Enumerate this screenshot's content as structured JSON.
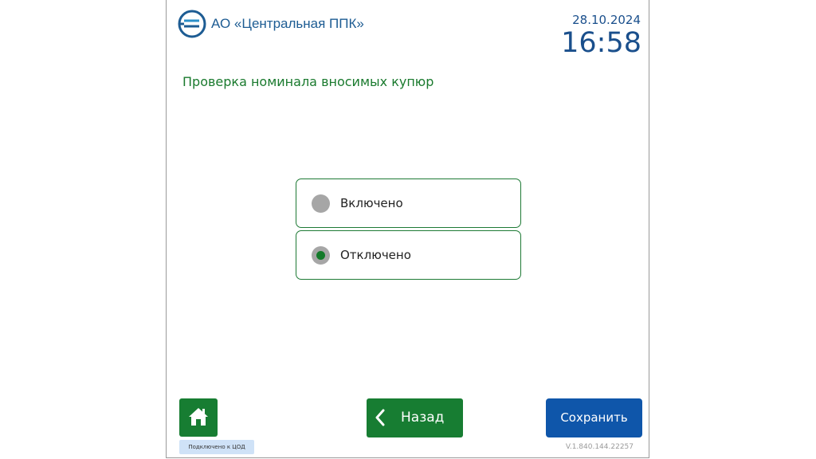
{
  "header": {
    "company": "АО «Центральная ППК»",
    "logo_icon": "company-logo-icon",
    "date": "28.10.2024",
    "time": "16:58"
  },
  "page": {
    "title": "Проверка номинала вносимых купюр"
  },
  "options": [
    {
      "label": "Включено",
      "selected": false
    },
    {
      "label": "Отключено",
      "selected": true
    }
  ],
  "footer": {
    "home_icon": "home-icon",
    "status": "Подключено к ЦОД",
    "back_label": "Назад",
    "back_icon": "chevron-left-icon",
    "save_label": "Сохранить",
    "version": "V.1.840.144.22257"
  },
  "colors": {
    "brand_blue": "#1a4f8c",
    "accent_green": "#177d32",
    "save_blue": "#0f56aa",
    "status_bg": "#cfe2f7"
  }
}
